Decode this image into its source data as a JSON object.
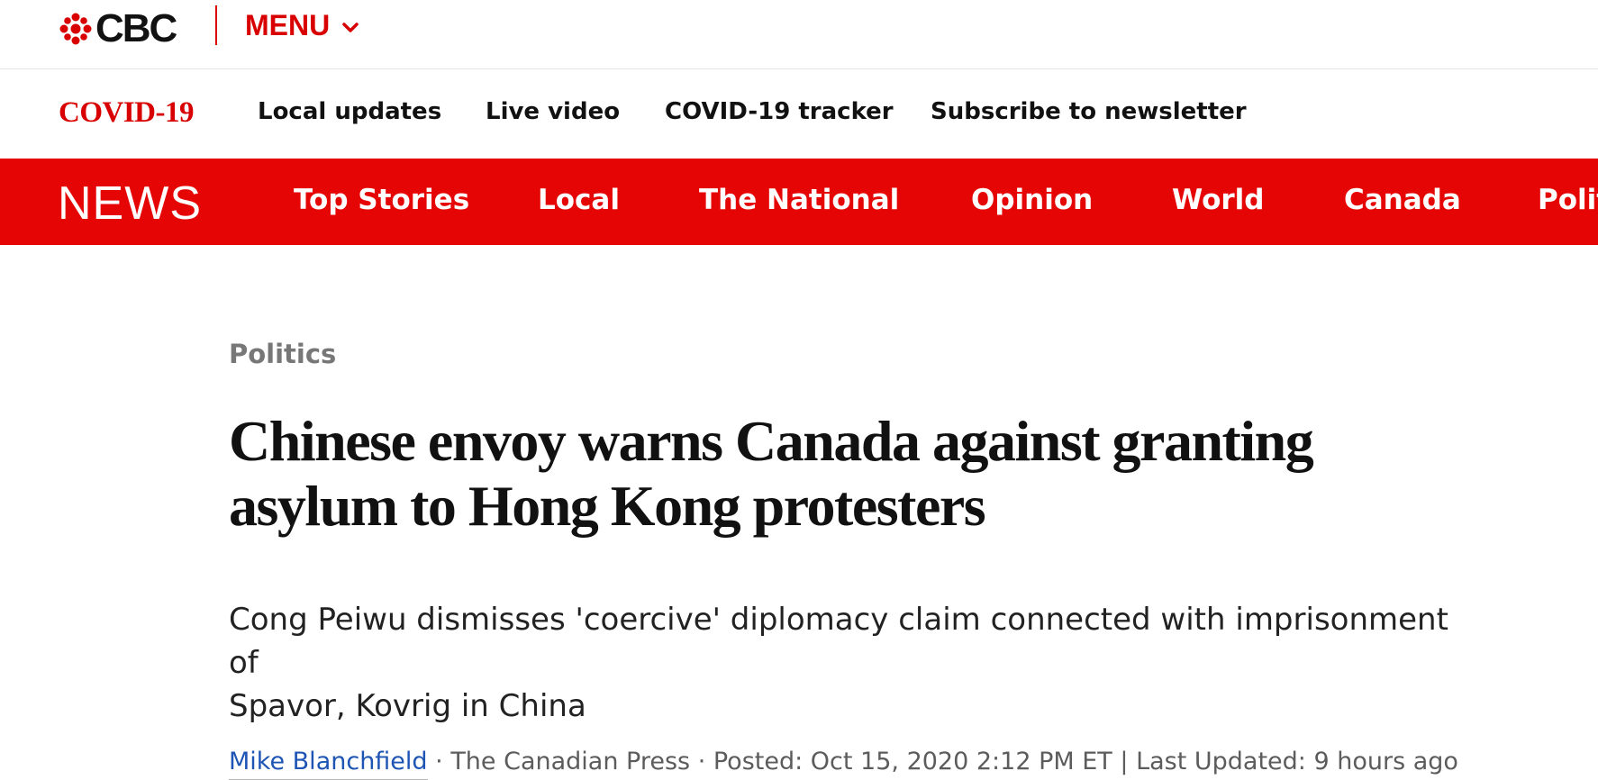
{
  "header": {
    "logo_text": "CBC",
    "menu_label": "MENU"
  },
  "covid_bar": {
    "brand": "COVID-19",
    "links": [
      "Local updates",
      "Live video",
      "COVID-19 tracker",
      "Subscribe to newsletter"
    ]
  },
  "news_bar": {
    "brand": "NEWS",
    "links": [
      "Top Stories",
      "Local",
      "The National",
      "Opinion",
      "World",
      "Canada",
      "Polit"
    ]
  },
  "article": {
    "section": "Politics",
    "headline_line1": "Chinese envoy warns Canada against granting",
    "headline_line2": "asylum to Hong Kong protesters",
    "dek_line1": "Cong Peiwu dismisses 'coercive' diplomacy claim connected with imprisonment of",
    "dek_line2": "Spavor, Kovrig in China",
    "byline": {
      "author": "Mike Blanchfield",
      "sep1": " · ",
      "source": "The Canadian Press",
      "sep2": " · ",
      "posted": "Posted: Oct 15, 2020 2:12 PM ET",
      "sep3": " | ",
      "updated": "Last Updated: 9 hours ago"
    }
  },
  "colors": {
    "brand_red": "#e60505",
    "link_blue": "#1e55b5"
  }
}
